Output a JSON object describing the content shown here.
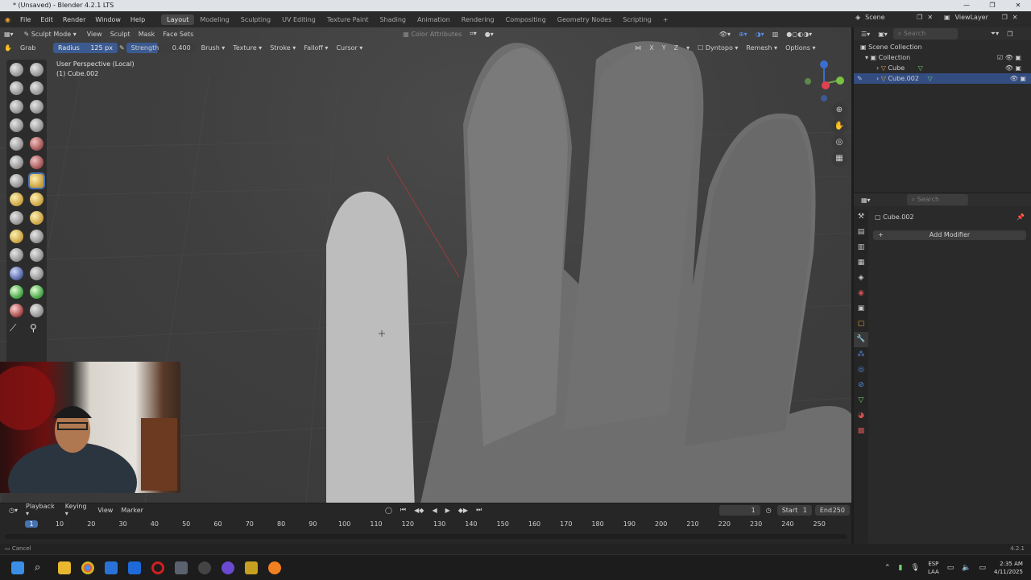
{
  "window": {
    "title": "* (Unsaved) - Blender 4.2.1 LTS"
  },
  "menu": {
    "items": [
      "File",
      "Edit",
      "Render",
      "Window",
      "Help"
    ]
  },
  "workspaces": [
    "Layout",
    "Modeling",
    "Sculpting",
    "UV Editing",
    "Texture Paint",
    "Shading",
    "Animation",
    "Rendering",
    "Compositing",
    "Geometry Nodes",
    "Scripting"
  ],
  "scene": {
    "name": "Scene",
    "view_layer": "ViewLayer"
  },
  "viewport_header": {
    "mode": "Sculpt Mode",
    "menus": [
      "View",
      "Sculpt",
      "Mask",
      "Face Sets"
    ],
    "color_attributes": "Color Attributes"
  },
  "tool_header": {
    "tool": "Grab",
    "radius_label": "Radius",
    "radius_value": "125 px",
    "strength_label": "Strength",
    "strength_value": "0.400",
    "menus": [
      "Brush",
      "Texture",
      "Stroke",
      "Falloff",
      "Cursor"
    ],
    "axes": [
      "X",
      "Y",
      "Z"
    ],
    "dyntopo": "Dyntopo",
    "remesh": "Remesh",
    "options": "Options"
  },
  "viewport_info": {
    "line1": "User Perspective (Local)",
    "line2": "(1) Cube.002"
  },
  "outliner": {
    "search_placeholder": "Search",
    "root": "Scene Collection",
    "collection": "Collection",
    "objects": [
      "Cube",
      "Cube.002"
    ]
  },
  "properties": {
    "search_placeholder": "Search",
    "object_name": "Cube.002",
    "add_modifier": "Add Modifier"
  },
  "timeline": {
    "menus": [
      "Playback",
      "Keying",
      "View",
      "Marker"
    ],
    "current_frame": "1",
    "start_label": "Start",
    "start": "1",
    "end_label": "End",
    "end": "250",
    "ticks": [
      "1",
      "10",
      "20",
      "30",
      "40",
      "50",
      "60",
      "70",
      "80",
      "90",
      "100",
      "110",
      "120",
      "130",
      "140",
      "150",
      "160",
      "170",
      "180",
      "190",
      "200",
      "210",
      "220",
      "230",
      "240",
      "250"
    ]
  },
  "status": {
    "left": "Cancel",
    "version": "4.2.1"
  },
  "taskbar": {
    "lang1": "ESP",
    "lang2": "LAA",
    "time": "2:35 AM",
    "date": "4/11/2025"
  }
}
